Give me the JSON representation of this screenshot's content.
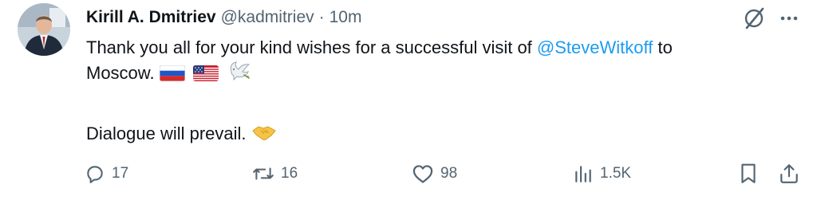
{
  "author": {
    "name": "Kirill A. Dmitriev",
    "handle": "@kadmitriev",
    "separator": "·",
    "time": "10m"
  },
  "tweet": {
    "line1_text": "Thank you all for your kind wishes for a successful visit of",
    "mention": "@SteveWitkoff",
    "line1_end": "to",
    "line2_text": "Moscow.",
    "line3_text": "Dialogue will prevail."
  },
  "emoji": [
    "russia-flag",
    "usa-flag",
    "dove-of-peace",
    "handshake"
  ],
  "actions": {
    "replies": "17",
    "reposts": "16",
    "likes": "98",
    "views": "1.5K"
  },
  "colors": {
    "text": "#0f1419",
    "secondary": "#536471",
    "mention": "#1d9bf0"
  }
}
